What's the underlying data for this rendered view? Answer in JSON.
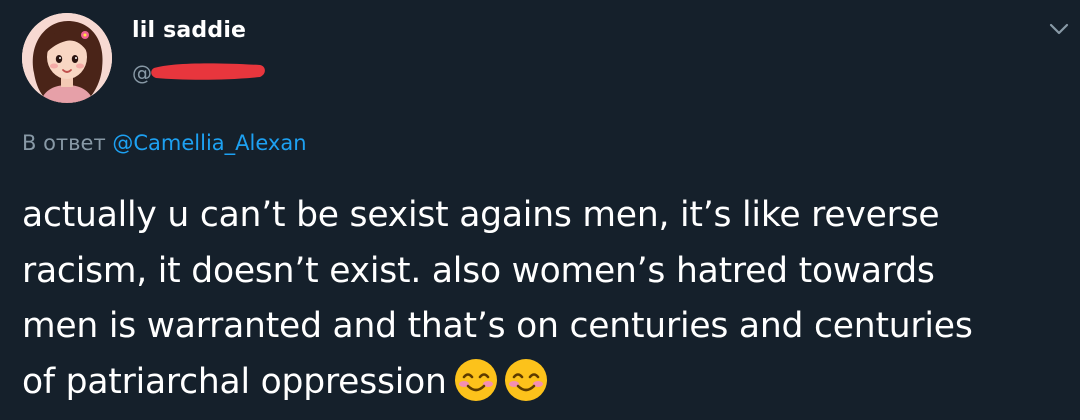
{
  "author": {
    "display_name": "lil saddie",
    "handle_prefix": "@",
    "avatar_icon": "cartoon-girl-avatar",
    "handle_redacted": true,
    "redaction_color": "#e8363d"
  },
  "reply": {
    "prefix": "В ответ",
    "handle": "@Camellia_Alexan"
  },
  "tweet": {
    "lines": [
      "actually u can’t be sexist agains men, it’s like reverse",
      "racism, it doesn’t exist. also women’s hatred towards",
      "men is warranted and that’s on centuries and centuries",
      "of patriarchal oppression"
    ],
    "trailing_emoji": [
      "smiling-face-with-smiling-eyes-icon",
      "smiling-face-with-smiling-eyes-icon"
    ]
  },
  "menu": {
    "icon": "chevron-down-icon"
  },
  "colors": {
    "background": "#15202b",
    "text_primary": "#ffffff",
    "text_secondary": "#8899a6",
    "link": "#1da1f2"
  }
}
